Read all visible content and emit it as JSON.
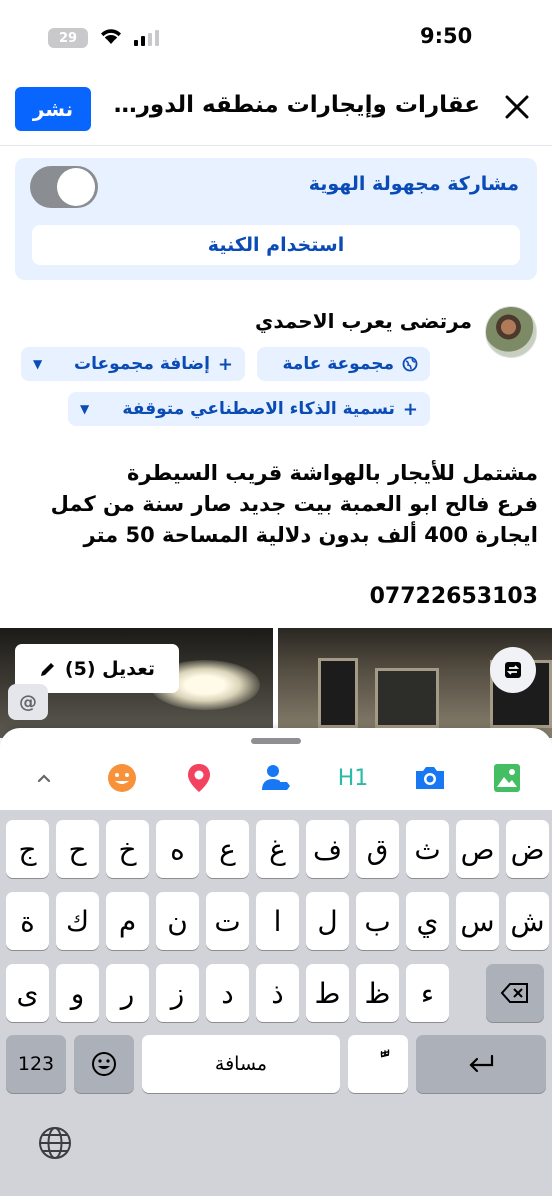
{
  "status_bar": {
    "time": "9:50",
    "battery": "29"
  },
  "header": {
    "title": "عقارات وإيجارات منطقه الدوره...",
    "post_label": "نشر"
  },
  "anonymous": {
    "label": "مشاركة مجهولة الهوية",
    "alias_button": "استخدام الكنية"
  },
  "user": {
    "name": "مرتضى يعرب الاحمدي"
  },
  "chips": {
    "public_group": "مجموعة عامة",
    "add_groups": "إضافة مجموعات",
    "ai_label": "تسمية الذكاء الاصطناعي متوقفة"
  },
  "post": {
    "line1": "مشتمل للأيجار بالهواشة  قريب السيطرة",
    "line2": "فرع فالح ابو العمبة بيت جديد  صار سنة من كمل",
    "line3": "ايجارة 400 ألف بدون دلالية المساحة 50 متر",
    "phone": "07722653103"
  },
  "photos": {
    "edit_label": "تعديل (5)",
    "mention_symbol": "@"
  },
  "toolbar": {
    "icons": [
      "chevron-up-icon",
      "emoji-icon",
      "location-icon",
      "tag-people-icon",
      "heading-icon",
      "camera-icon",
      "photo-icon"
    ],
    "heading_text": "H1",
    "colors": {
      "emoji": "#f7923a",
      "location": "#f3425f",
      "tag": "#1877f2",
      "heading": "#2abba7",
      "camera": "#1877f2",
      "photo": "#45bd62"
    }
  },
  "keyboard": {
    "row1": [
      "ض",
      "ص",
      "ث",
      "ق",
      "ف",
      "غ",
      "ع",
      "ه",
      "خ",
      "ح",
      "ج"
    ],
    "row2": [
      "ش",
      "س",
      "ي",
      "ب",
      "ل",
      "ا",
      "ت",
      "ن",
      "م",
      "ك",
      "ة"
    ],
    "row3": [
      "ء",
      "ظ",
      "ط",
      "ذ",
      "د",
      "ز",
      "ر",
      "و",
      "ى"
    ],
    "numbers_label": "123",
    "space_label": "مسافة",
    "diacritic_label": "ًّ"
  },
  "accent_color": "#0866ff"
}
